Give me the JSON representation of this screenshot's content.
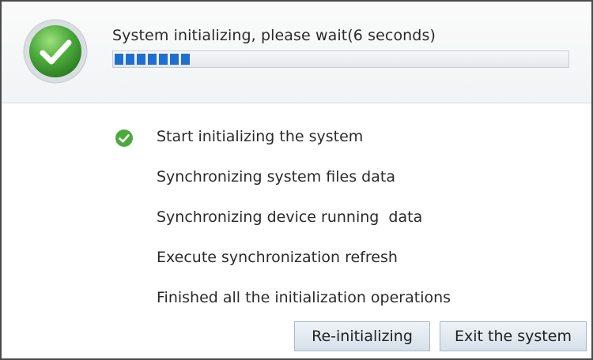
{
  "header": {
    "title": "System initializing, please wait(6 seconds)",
    "icon": "success-check-icon"
  },
  "progress": {
    "fraction": 0.17,
    "color": "#1f6fd0"
  },
  "steps": [
    {
      "label": "Start initializing the system",
      "done": true
    },
    {
      "label": "Synchronizing system files data",
      "done": false
    },
    {
      "label": "Synchronizing device running  data",
      "done": false
    },
    {
      "label": "Execute synchronization refresh",
      "done": false
    },
    {
      "label": "Finished all the initialization operations",
      "done": false
    }
  ],
  "buttons": {
    "reinit_label": "Re-initializing",
    "exit_label": "Exit the system"
  },
  "colors": {
    "success_green": "#4caa3c",
    "accent_blue": "#1f6fd0"
  }
}
